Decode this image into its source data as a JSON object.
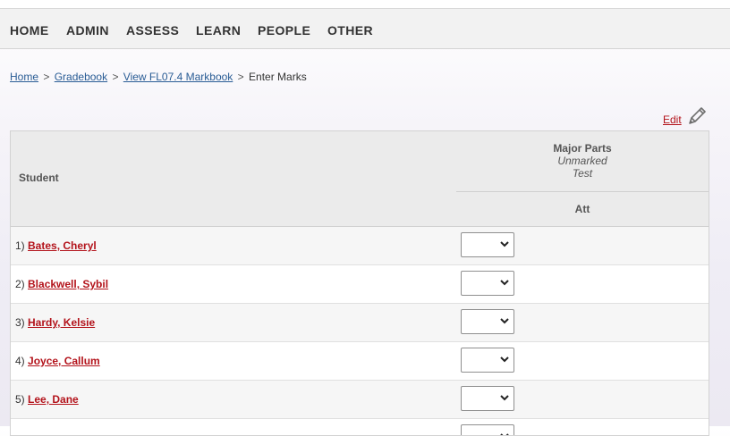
{
  "nav": {
    "items": [
      {
        "label": "HOME"
      },
      {
        "label": "ADMIN"
      },
      {
        "label": "ASSESS"
      },
      {
        "label": "LEARN"
      },
      {
        "label": "PEOPLE"
      },
      {
        "label": "OTHER"
      }
    ]
  },
  "breadcrumb": {
    "items": [
      {
        "label": "Home",
        "link": true
      },
      {
        "label": "Gradebook",
        "link": true
      },
      {
        "label": "View FL07.4 Markbook",
        "link": true
      },
      {
        "label": "Enter Marks",
        "link": false
      }
    ],
    "separator": ">"
  },
  "edit": {
    "label": "Edit",
    "icon": "pencil-icon"
  },
  "table": {
    "student_header": "Student",
    "group_title": "Major Parts",
    "group_sub1": "Unmarked",
    "group_sub2": "Test",
    "column": "Att",
    "rows": [
      {
        "num": "1)",
        "name": "Bates, Cheryl",
        "value": ""
      },
      {
        "num": "2)",
        "name": "Blackwell, Sybil",
        "value": ""
      },
      {
        "num": "3)",
        "name": "Hardy, Kelsie",
        "value": ""
      },
      {
        "num": "4)",
        "name": "Joyce, Callum",
        "value": ""
      },
      {
        "num": "5)",
        "name": "Lee, Dane",
        "value": ""
      },
      {
        "num": "",
        "name": "",
        "value": ""
      }
    ]
  },
  "colors": {
    "link_red": "#b3131b",
    "link_blue": "#2a5c95",
    "nav_bg": "#f2f2f2",
    "header_bg": "#ebebeb"
  }
}
